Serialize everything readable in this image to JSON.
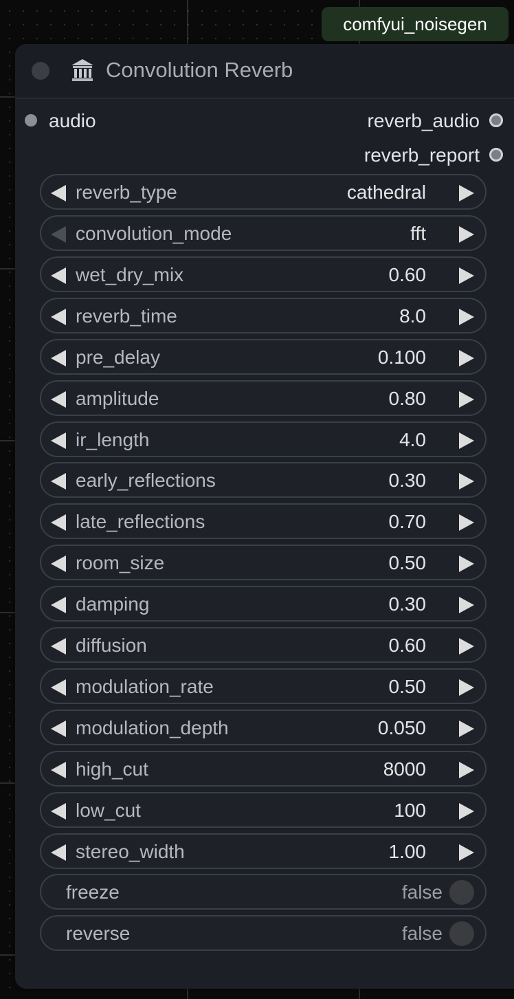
{
  "badge": {
    "label": "comfyui_noisegen"
  },
  "node": {
    "title": "Convolution Reverb",
    "icon": "temple-icon"
  },
  "inputs": [
    {
      "label": "audio"
    }
  ],
  "outputs": [
    {
      "label": "reverb_audio"
    },
    {
      "label": "reverb_report"
    }
  ],
  "widgets": [
    {
      "label": "reverb_type",
      "value": "cathedral"
    },
    {
      "label": "convolution_mode",
      "value": "fft"
    },
    {
      "label": "wet_dry_mix",
      "value": "0.60"
    },
    {
      "label": "reverb_time",
      "value": "8.0"
    },
    {
      "label": "pre_delay",
      "value": "0.100"
    },
    {
      "label": "amplitude",
      "value": "0.80"
    },
    {
      "label": "ir_length",
      "value": "4.0"
    },
    {
      "label": "early_reflections",
      "value": "0.30"
    },
    {
      "label": "late_reflections",
      "value": "0.70"
    },
    {
      "label": "room_size",
      "value": "0.50"
    },
    {
      "label": "damping",
      "value": "0.30"
    },
    {
      "label": "diffusion",
      "value": "0.60"
    },
    {
      "label": "modulation_rate",
      "value": "0.50"
    },
    {
      "label": "modulation_depth",
      "value": "0.050"
    },
    {
      "label": "high_cut",
      "value": "8000"
    },
    {
      "label": "low_cut",
      "value": "100"
    },
    {
      "label": "stereo_width",
      "value": "1.00"
    }
  ],
  "toggles": [
    {
      "label": "freeze",
      "value": "false"
    },
    {
      "label": "reverse",
      "value": "false"
    }
  ],
  "colors": {
    "node_bg": "#1c2026",
    "badge_bg": "#1f3320",
    "widget_border": "#3a3f47"
  }
}
